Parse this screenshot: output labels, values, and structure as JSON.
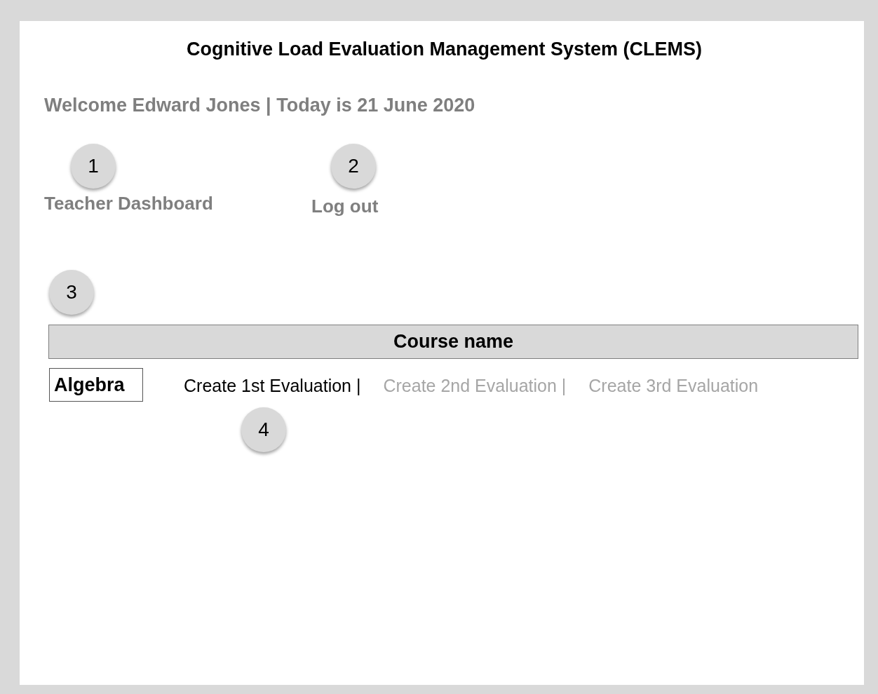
{
  "title": "Cognitive Load Evaluation Management System (CLEMS)",
  "welcome": "Welcome Edward Jones | Today is 21 June 2020",
  "nav": [
    {
      "label": "Teacher Dashboard",
      "marker": "1"
    },
    {
      "label": "Log out",
      "marker": "2"
    }
  ],
  "table": {
    "marker": "3",
    "header": "Course name",
    "rows": [
      {
        "course": "Algebra",
        "evaluations": [
          {
            "label": "Create 1st Evaluation |",
            "disabled": false,
            "marker": "4"
          },
          {
            "label": "Create 2nd Evaluation |",
            "disabled": true
          },
          {
            "label": "Create 3rd Evaluation",
            "disabled": true
          }
        ]
      }
    ]
  }
}
